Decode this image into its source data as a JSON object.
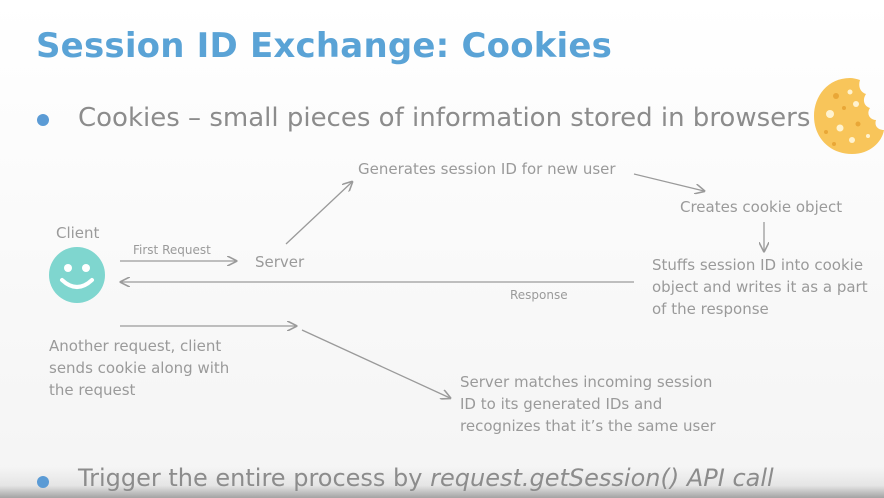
{
  "title": "Session ID Exchange: Cookies",
  "bullet1": "Cookies – small pieces of information stored in browsers",
  "bullet2": {
    "prefix": "Trigger the entire process by ",
    "emphasis": "request.getSession() API call"
  },
  "diagram": {
    "client_label": "Client",
    "first_request": "First Request",
    "server_label": "Server",
    "generates": "Generates session ID for new user",
    "creates_cookie": "Creates cookie object",
    "stuffs_line1": "Stuffs session ID into cookie",
    "stuffs_line2": "object and writes it as a part",
    "stuffs_line3": "of the response",
    "response_label": "Response",
    "another_line1": "Another request, client",
    "another_line2": "sends cookie along with",
    "another_line3": "the request",
    "matches_line1": "Server matches incoming session",
    "matches_line2": "ID to its generated IDs and",
    "matches_line3": "recognizes that it’s the same user"
  },
  "colors": {
    "title": "#5aa3d6",
    "bullet": "#5b9bd5",
    "face": "#7fd6cf",
    "cookie": "#f8c55a"
  },
  "icons": {
    "client": "smiley-face-icon",
    "cookie": "cookie-icon"
  }
}
